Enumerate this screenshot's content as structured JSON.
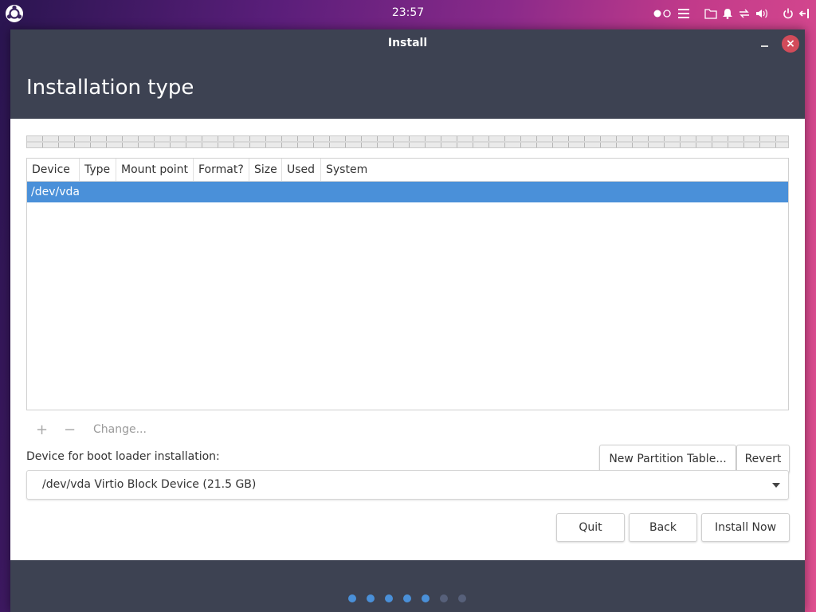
{
  "topbar": {
    "clock": "23:57",
    "logo_icon": "ubuntu-logo-icon",
    "tray_icons": [
      "toggle-dots-icon",
      "menu-icon",
      "folder-icon",
      "bell-icon",
      "network-icon",
      "volume-icon",
      "power-icon",
      "logout-icon"
    ]
  },
  "window": {
    "title": "Install",
    "close_glyph": "×"
  },
  "page": {
    "heading": "Installation type"
  },
  "partition_table": {
    "columns": [
      "Device",
      "Type",
      "Mount point",
      "Format?",
      "Size",
      "Used",
      "System"
    ],
    "rows": [
      {
        "device": "/dev/vda",
        "selected": true
      }
    ]
  },
  "tools": {
    "add_glyph": "+",
    "remove_glyph": "−",
    "change_label": "Change...",
    "new_table_label": "New Partition Table...",
    "revert_label": "Revert"
  },
  "bootloader": {
    "label": "Device for boot loader installation:",
    "selected": "/dev/vda Virtio Block Device (21.5 GB)"
  },
  "actions": {
    "quit_label": "Quit",
    "back_label": "Back",
    "install_label": "Install Now"
  },
  "progress": {
    "total_steps": 7,
    "completed_steps": 5,
    "active_color": "#4a90d9",
    "inactive_color": "#57607a"
  },
  "colors": {
    "header_bg": "#3d4252",
    "selection": "#4a90d9",
    "close_button": "#d24b5a"
  }
}
